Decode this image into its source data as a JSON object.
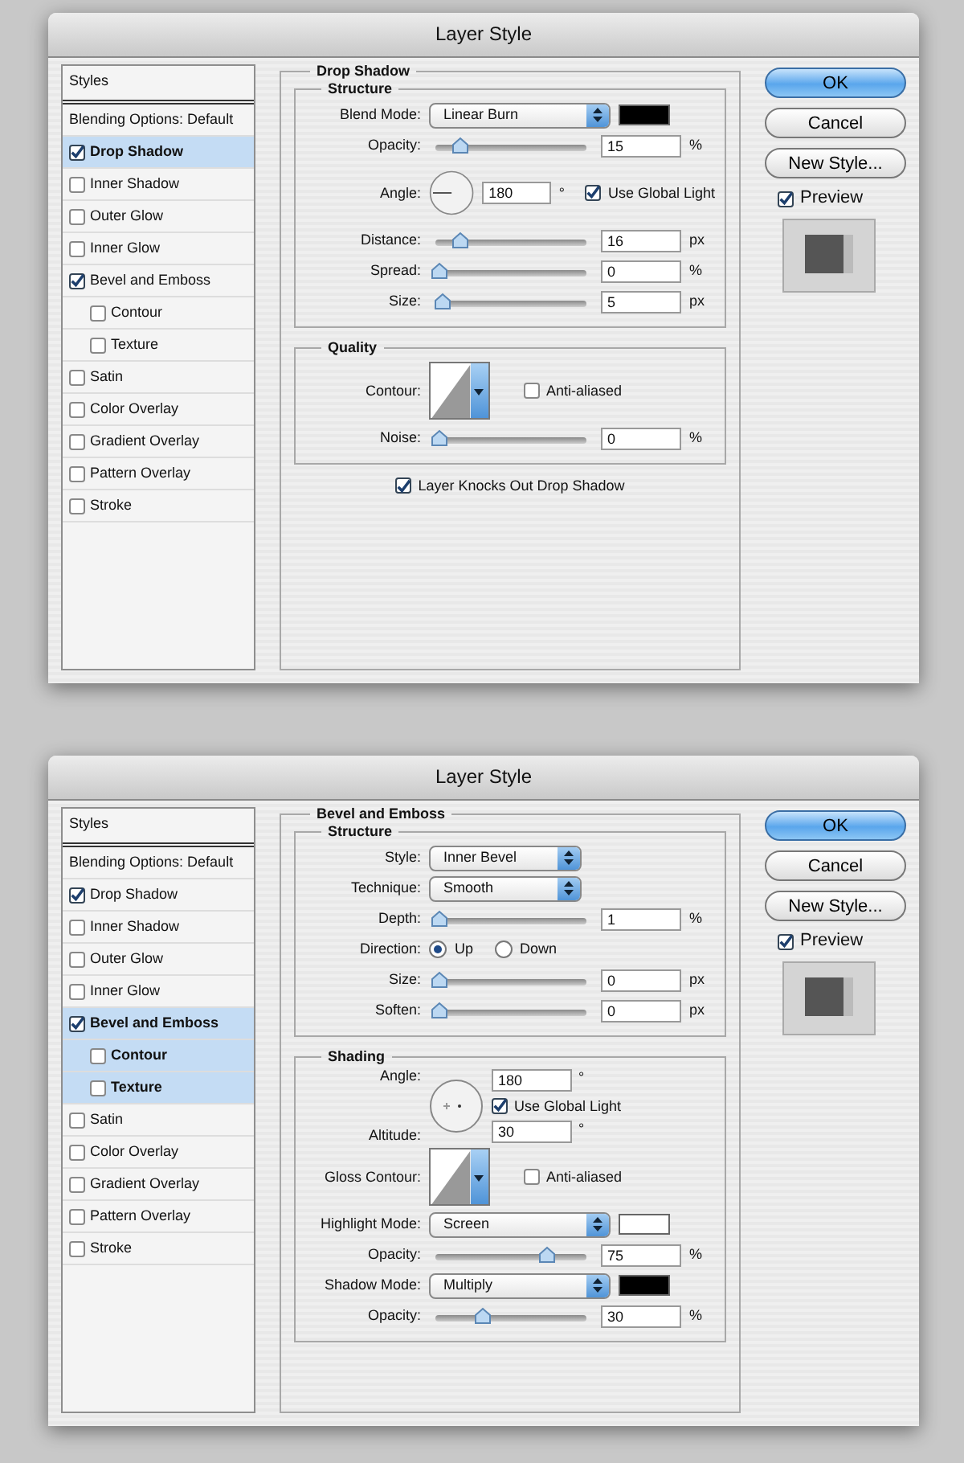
{
  "dialogs": [
    {
      "title": "Layer Style",
      "styles_header": "Styles",
      "styles": [
        {
          "kind": "header",
          "label": "Blending Options: Default",
          "selected": false
        },
        {
          "kind": "check",
          "label": "Drop Shadow",
          "checked": true,
          "selected": true
        },
        {
          "kind": "check",
          "label": "Inner Shadow",
          "checked": false,
          "selected": false
        },
        {
          "kind": "check",
          "label": "Outer Glow",
          "checked": false,
          "selected": false
        },
        {
          "kind": "check",
          "label": "Inner Glow",
          "checked": false,
          "selected": false
        },
        {
          "kind": "check",
          "label": "Bevel and Emboss",
          "checked": true,
          "selected": false,
          "children": [
            {
              "label": "Contour",
              "checked": false,
              "selected": false
            },
            {
              "label": "Texture",
              "checked": false,
              "selected": false
            }
          ]
        },
        {
          "kind": "check",
          "label": "Satin",
          "checked": false,
          "selected": false
        },
        {
          "kind": "check",
          "label": "Color Overlay",
          "checked": false,
          "selected": false
        },
        {
          "kind": "check",
          "label": "Gradient Overlay",
          "checked": false,
          "selected": false
        },
        {
          "kind": "check",
          "label": "Pattern Overlay",
          "checked": false,
          "selected": false
        },
        {
          "kind": "check",
          "label": "Stroke",
          "checked": false,
          "selected": false
        }
      ],
      "panel": {
        "title": "Drop Shadow",
        "groups": [
          {
            "title": "Structure",
            "rows": [
              {
                "kind": "select",
                "label": "Blend Mode:",
                "value": "Linear Burn",
                "color": "#000000"
              },
              {
                "kind": "slider",
                "label": "Opacity:",
                "level": 0.15,
                "value": "15",
                "unit": "%"
              },
              {
                "kind": "angle",
                "label": "Angle:",
                "value": "180",
                "unit": "°",
                "check": {
                  "label": "Use Global Light",
                  "checked": true
                }
              },
              {
                "kind": "slider",
                "label": "Distance:",
                "level": 0.15,
                "value": "16",
                "unit": "px"
              },
              {
                "kind": "slider",
                "label": "Spread:",
                "level": 0,
                "value": "0",
                "unit": "%"
              },
              {
                "kind": "slider",
                "label": "Size:",
                "level": 0.02,
                "value": "5",
                "unit": "px"
              }
            ]
          },
          {
            "title": "Quality",
            "rows": [
              {
                "kind": "contour",
                "label": "Contour:",
                "check": {
                  "label": "Anti-aliased",
                  "checked": false
                }
              },
              {
                "kind": "slider",
                "label": "Noise:",
                "level": 0,
                "value": "0",
                "unit": "%"
              }
            ]
          }
        ],
        "footer": [
          {
            "label": "Layer Knocks Out Drop Shadow",
            "checked": true
          }
        ]
      },
      "buttons": [
        {
          "label": "OK",
          "kind": "default"
        },
        {
          "label": "Cancel",
          "kind": "normal"
        },
        {
          "label": "New Style...",
          "kind": "normal"
        }
      ],
      "preview": {
        "label": "Preview",
        "checked": true
      }
    },
    {
      "title": "Layer Style",
      "styles_header": "Styles",
      "styles": [
        {
          "kind": "header",
          "label": "Blending Options: Default",
          "selected": false
        },
        {
          "kind": "check",
          "label": "Drop Shadow",
          "checked": true,
          "selected": false
        },
        {
          "kind": "check",
          "label": "Inner Shadow",
          "checked": false,
          "selected": false
        },
        {
          "kind": "check",
          "label": "Outer Glow",
          "checked": false,
          "selected": false
        },
        {
          "kind": "check",
          "label": "Inner Glow",
          "checked": false,
          "selected": false
        },
        {
          "kind": "check",
          "label": "Bevel and Emboss",
          "checked": true,
          "selected": true,
          "children": [
            {
              "label": "Contour",
              "checked": false,
              "selected": true
            },
            {
              "label": "Texture",
              "checked": false,
              "selected": true
            }
          ]
        },
        {
          "kind": "check",
          "label": "Satin",
          "checked": false,
          "selected": false
        },
        {
          "kind": "check",
          "label": "Color Overlay",
          "checked": false,
          "selected": false
        },
        {
          "kind": "check",
          "label": "Gradient Overlay",
          "checked": false,
          "selected": false
        },
        {
          "kind": "check",
          "label": "Pattern Overlay",
          "checked": false,
          "selected": false
        },
        {
          "kind": "check",
          "label": "Stroke",
          "checked": false,
          "selected": false
        }
      ],
      "panel": {
        "title": "Bevel and Emboss",
        "groups": [
          {
            "title": "Structure",
            "rows": [
              {
                "kind": "select",
                "label": "Style:",
                "value": "Inner Bevel"
              },
              {
                "kind": "select",
                "label": "Technique:",
                "value": "Smooth"
              },
              {
                "kind": "slider",
                "label": "Depth:",
                "level": 0,
                "value": "1",
                "unit": "%"
              },
              {
                "kind": "radio",
                "label": "Direction:",
                "options": [
                  {
                    "label": "Up",
                    "selected": true
                  },
                  {
                    "label": "Down",
                    "selected": false
                  }
                ]
              },
              {
                "kind": "slider",
                "label": "Size:",
                "level": 0,
                "value": "0",
                "unit": "px"
              },
              {
                "kind": "slider",
                "label": "Soften:",
                "level": 0,
                "value": "0",
                "unit": "px"
              }
            ]
          },
          {
            "title": "Shading",
            "rows": [
              {
                "kind": "light",
                "angle_label": "Angle:",
                "angle": "180",
                "altitude_label": "Altitude:",
                "altitude": "30",
                "unit": "°",
                "check": {
                  "label": "Use Global Light",
                  "checked": true
                }
              },
              {
                "kind": "contour",
                "label": "Gloss Contour:",
                "check": {
                  "label": "Anti-aliased",
                  "checked": false
                }
              },
              {
                "kind": "select",
                "label": "Highlight Mode:",
                "value": "Screen",
                "color": "#ffffff"
              },
              {
                "kind": "slider",
                "label": "Opacity:",
                "level": 0.75,
                "value": "75",
                "unit": "%"
              },
              {
                "kind": "select",
                "label": "Shadow Mode:",
                "value": "Multiply",
                "color": "#000000"
              },
              {
                "kind": "slider",
                "label": "Opacity:",
                "level": 0.3,
                "value": "30",
                "unit": "%"
              }
            ]
          }
        ]
      },
      "buttons": [
        {
          "label": "OK",
          "kind": "default"
        },
        {
          "label": "Cancel",
          "kind": "normal"
        },
        {
          "label": "New Style...",
          "kind": "normal"
        }
      ],
      "preview": {
        "label": "Preview",
        "checked": true
      }
    }
  ]
}
